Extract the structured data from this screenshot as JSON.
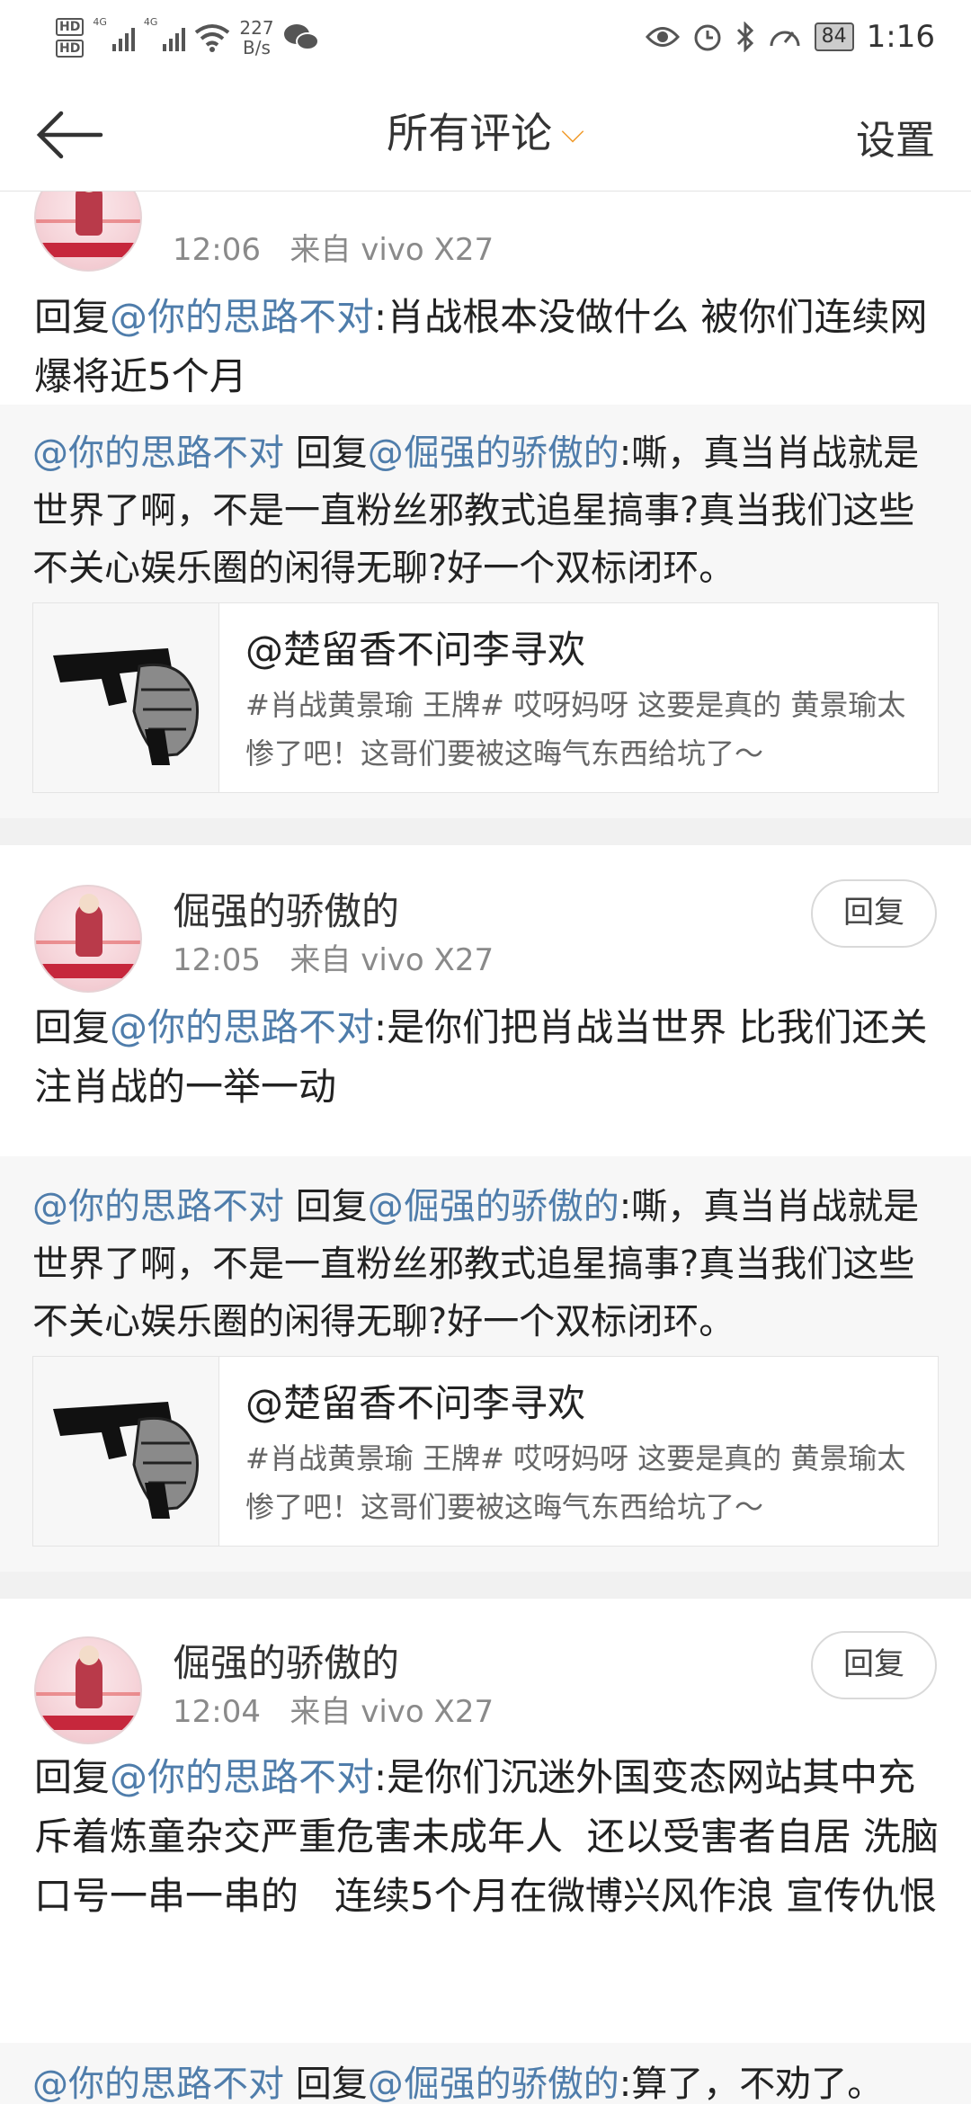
{
  "status_bar": {
    "hd1": "HD",
    "hd2": "HD",
    "net1": "4G",
    "net2": "4G",
    "speed_value": "227",
    "speed_unit": "B/s",
    "battery": "84",
    "time": "1:16"
  },
  "nav": {
    "title": "所有评论",
    "settings": "设置"
  },
  "comments": [
    {
      "time": "12:06",
      "source": "来自 vivo X27",
      "reply_prefix": "回复",
      "mention": "@你的思路不对",
      "text": ":肖战根本没做什么 被你们连续网爆将近5个月"
    },
    {
      "username": "倔强的骄傲的",
      "time": "12:05",
      "source": "来自 vivo X27",
      "reply_label": "回复",
      "reply_prefix": "回复",
      "mention": "@你的思路不对",
      "text": ":是你们把肖战当世界 比我们还关注肖战的一举一动"
    },
    {
      "username": "倔强的骄傲的",
      "time": "12:04",
      "source": "来自 vivo X27",
      "reply_label": "回复",
      "reply_prefix": "回复",
      "mention": "@你的思路不对",
      "text": ":是你们沉迷外国变态网站其中充斥着炼童杂交严重危害未成年人  还以受害者自居 洗脑口号一串一串的   连续5个月在微博兴风作浪 宣传仇恨"
    }
  ],
  "quotes": [
    {
      "author": "@你的思路不对",
      "reply_word": " 回复",
      "target": "@倔强的骄傲的",
      "text": ":嘶，真当肖战就是世界了啊，不是一直粉丝邪教式追星搞事?真当我们这些不关心娱乐圈的闲得无聊?好一个双标闭环。",
      "card_title": "@楚留香不问李寻欢",
      "card_desc": "#肖战黄景瑜 王牌# 哎呀妈呀 这要是真的 黄景瑜太惨了吧！这哥们要被这晦气东西给坑了～"
    },
    {
      "author": "@你的思路不对",
      "reply_word": " 回复",
      "target": "@倔强的骄傲的",
      "text": ":嘶，真当肖战就是世界了啊，不是一直粉丝邪教式追星搞事?真当我们这些不关心娱乐圈的闲得无聊?好一个双标闭环。",
      "card_title": "@楚留香不问李寻欢",
      "card_desc": "#肖战黄景瑜 王牌# 哎呀妈呀 这要是真的 黄景瑜太惨了吧！这哥们要被这晦气东西给坑了～"
    },
    {
      "author": "@你的思路不对",
      "reply_word": " 回复",
      "target": "@倔强的骄傲的",
      "text": ":算了，不劝了。"
    }
  ],
  "colors": {
    "link": "#4f7dab",
    "accent": "#f19b2c"
  }
}
